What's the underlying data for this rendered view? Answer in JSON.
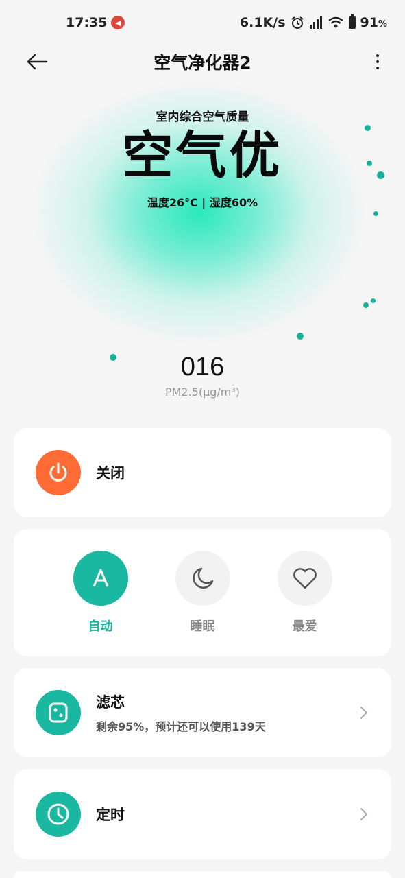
{
  "status_bar": {
    "time": "17:35",
    "net_speed": "6.1K/s",
    "battery_value": "91",
    "battery_unit": "%"
  },
  "header": {
    "title": "空气净化器2"
  },
  "hero": {
    "subtitle": "室内综合空气质量",
    "quality": "空气优",
    "env": "温度26°C | 湿度60%"
  },
  "pm": {
    "value": "016",
    "unit": "PM2.5(μg/m³)"
  },
  "power": {
    "label": "关闭",
    "color": "#ff6b35"
  },
  "modes": [
    {
      "label": "自动",
      "icon": "auto-A-icon",
      "active": true
    },
    {
      "label": "睡眠",
      "icon": "moon-icon",
      "active": false
    },
    {
      "label": "最爱",
      "icon": "heart-icon",
      "active": false
    }
  ],
  "filter": {
    "title": "滤芯",
    "desc": "剩余95%，预计还可以使用139天",
    "remaining": 95
  },
  "timer": {
    "title": "定时"
  },
  "colors": {
    "accent": "#1ab8a0",
    "power": "#ff6b35",
    "inactive_label": "#888888"
  }
}
